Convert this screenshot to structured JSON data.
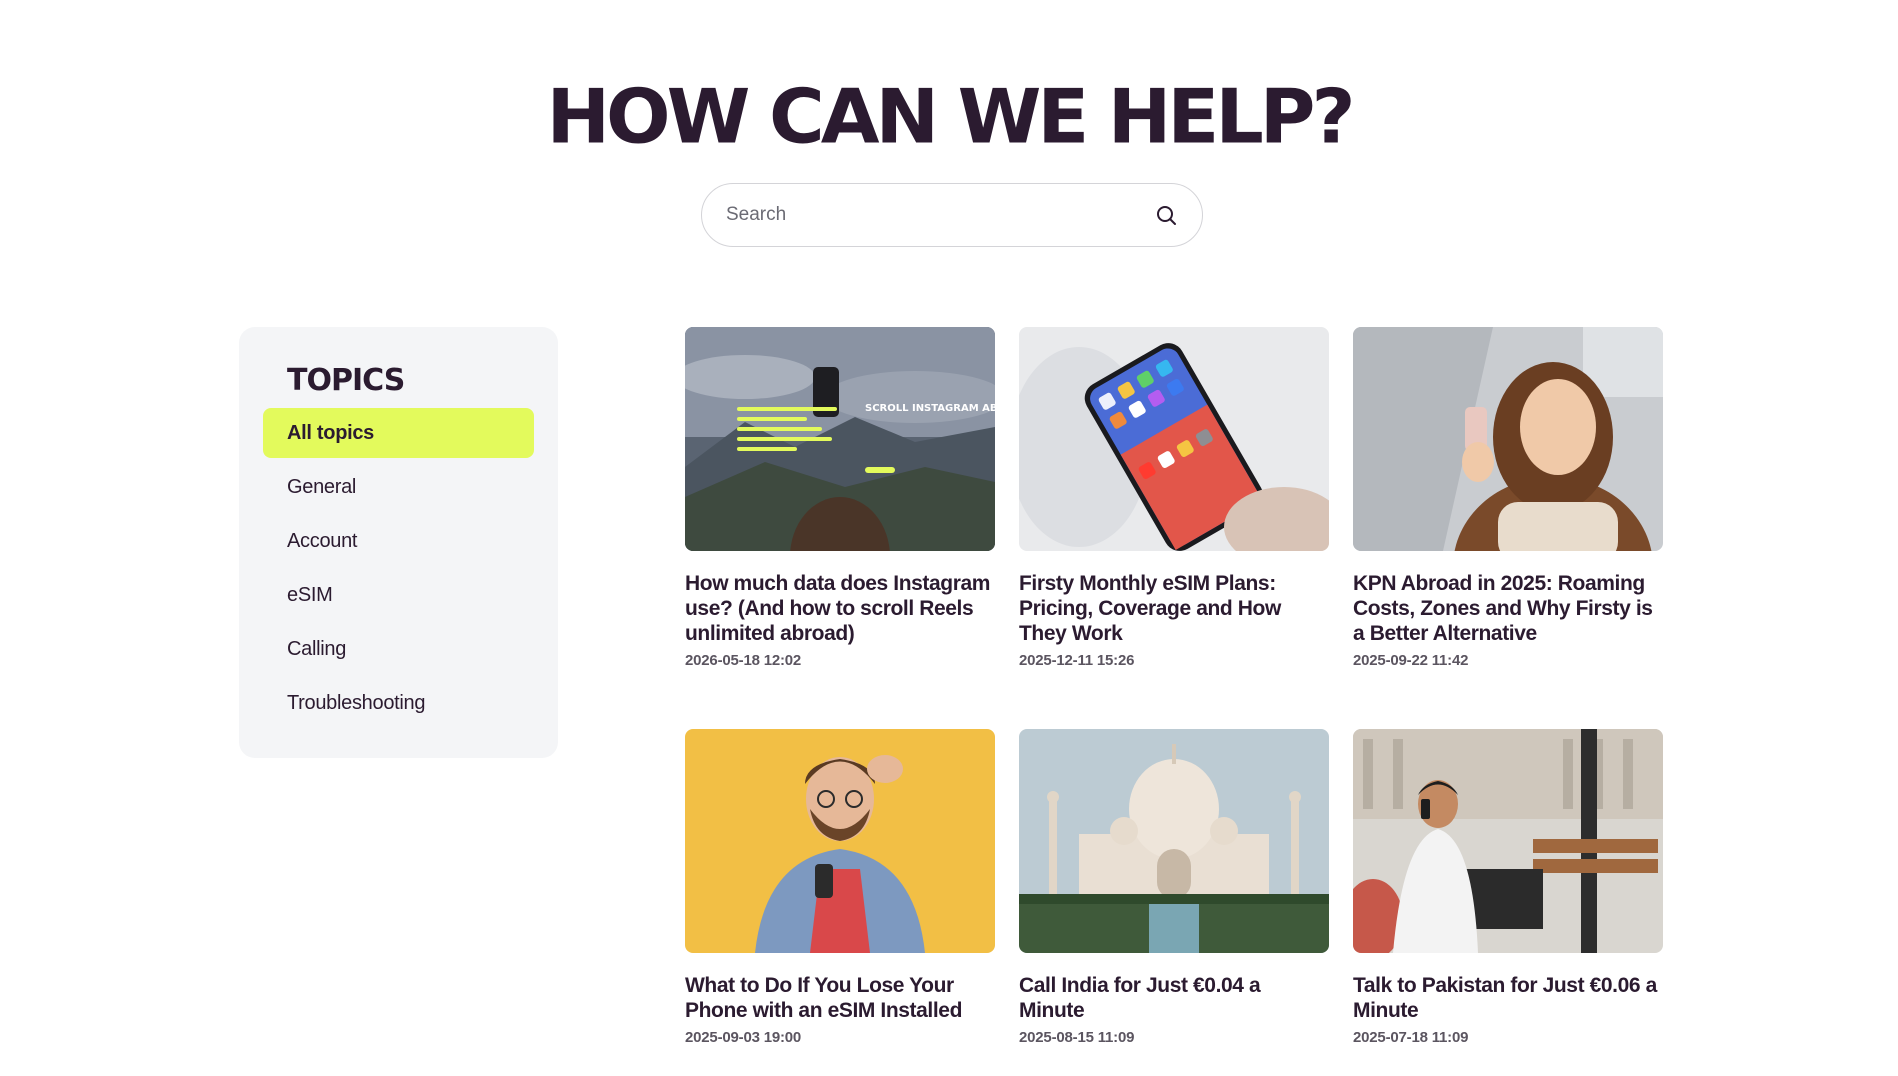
{
  "hero": {
    "title": "HOW CAN WE HELP?"
  },
  "search": {
    "placeholder": "Search"
  },
  "topics": {
    "title": "TOPICS",
    "items": [
      {
        "label": "All topics",
        "active": true
      },
      {
        "label": "General"
      },
      {
        "label": "Account"
      },
      {
        "label": "eSIM"
      },
      {
        "label": "Calling"
      },
      {
        "label": "Troubleshooting"
      }
    ]
  },
  "articles": [
    {
      "title": "How much data does Instagram use? (And how to scroll Reels unlimited abroad)",
      "date": "2026-05-18 12:02",
      "image": "instagram-abroad-promo",
      "image_text": {
        "heading": "SCROLL INSTAGRAM ABROAD. FOR FREE"
      }
    },
    {
      "title": "Firsty Monthly eSIM Plans: Pricing, Coverage and How They Work",
      "date": "2025-12-11 15:26",
      "image": "smartphone-in-hand"
    },
    {
      "title": "KPN Abroad in 2025: Roaming Costs, Zones and Why Firsty is a Better Alternative",
      "date": "2025-09-22 11:42",
      "image": "woman-with-phone"
    },
    {
      "title": "What to Do If You Lose Your Phone with an eSIM Installed",
      "date": "2025-09-03 19:00",
      "image": "worried-man-with-phone"
    },
    {
      "title": "Call India for Just €0.04 a Minute",
      "date": "2025-08-15 11:09",
      "image": "taj-mahal"
    },
    {
      "title": "Talk to Pakistan for Just €0.06 a Minute",
      "date": "2025-07-18 11:09",
      "image": "man-calling-on-bench"
    }
  ],
  "colors": {
    "accent": "#e3fa5c",
    "text": "#2b1b30",
    "panel": "#f4f5f7"
  }
}
